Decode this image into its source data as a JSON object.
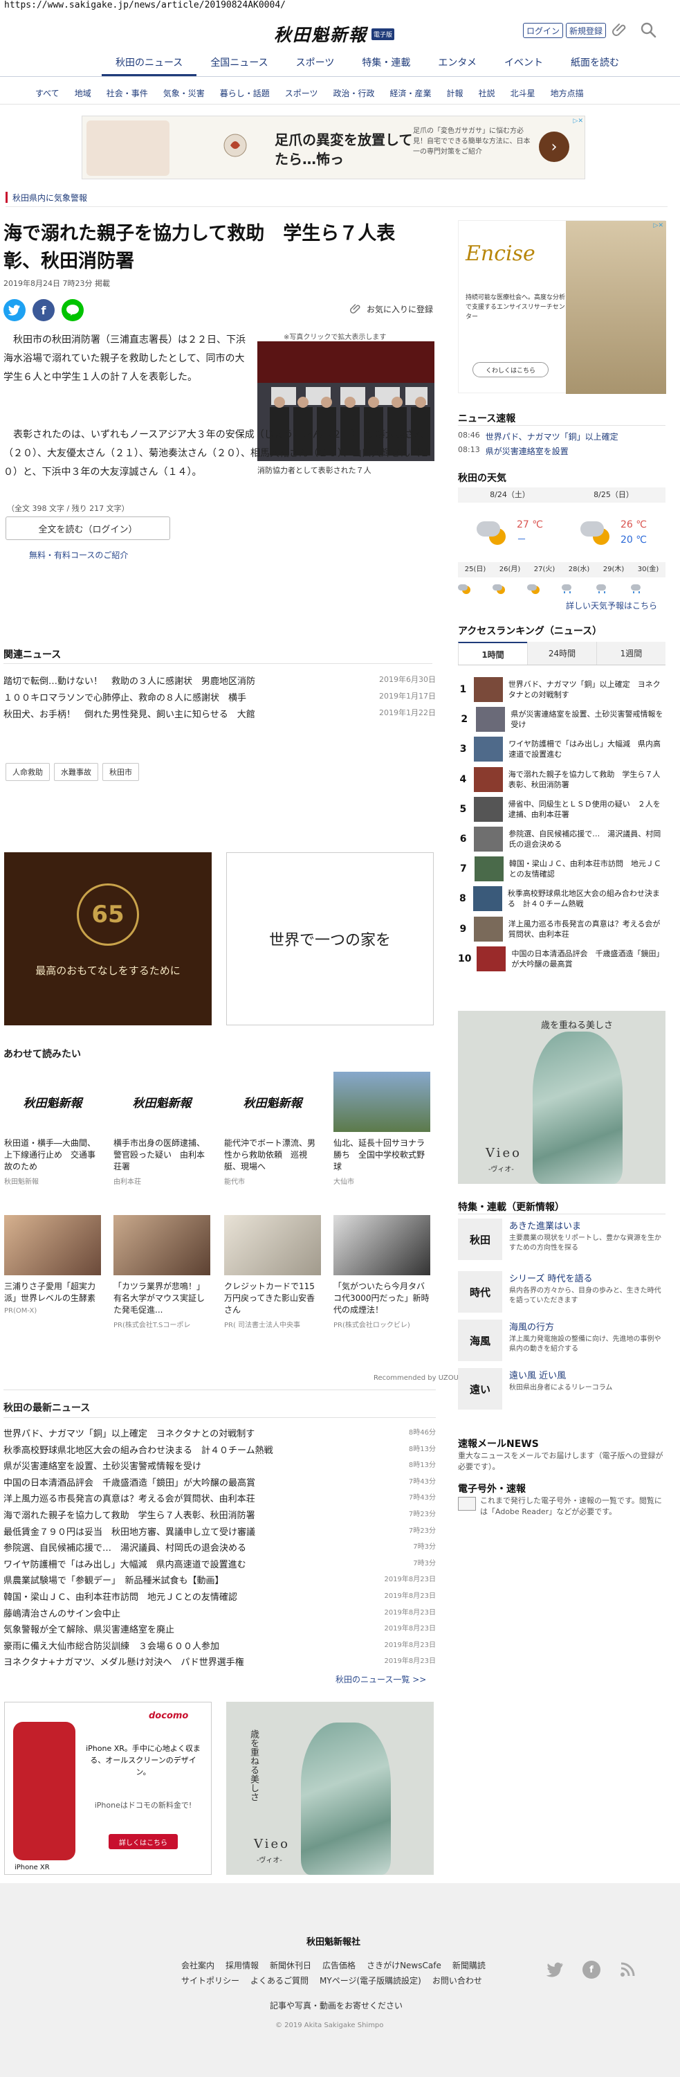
{
  "url": "https://www.sakigake.jp/news/article/20190824AK0004/",
  "header": {
    "logo_text": "秋田魁新報",
    "logo_badge": "電子版",
    "login": "ログイン",
    "register": "新規登録"
  },
  "main_nav": [
    "秋田のニュース",
    "全国ニュース",
    "スポーツ",
    "特集・連載",
    "エンタメ",
    "イベント",
    "紙面を読む"
  ],
  "sub_nav": [
    "すべて",
    "地域",
    "社会・事件",
    "気象・災害",
    "暮らし・話題",
    "スポーツ",
    "政治・行政",
    "経済・産業",
    "計報",
    "社説",
    "北斗星",
    "地方点描"
  ],
  "banner_ad": {
    "headline": "足爪の異変を放置してたら…怖っ",
    "subtext": "足爪の「変色ガサガサ」に悩む方必見！自宅でできる簡単な方法に、日本一の専門対策をご紹介",
    "ad_mark": "▷✕"
  },
  "alert": "秋田県内に気象警報",
  "article": {
    "title": "海で溺れた親子を協力して救助　学生ら７人表彰、秋田消防署",
    "date": "2019年8月24日 7時23分 掲載",
    "fav": "お気に入りに登録",
    "photo_hint": "※写真クリックで拡大表示します",
    "photo_caption": "消防協力者として表彰された７人",
    "para1": "秋田市の秋田消防署（三浦直志署長）は２２日、下浜海水浴場で溺れていた親子を救助したとして、同市の大学生６人と中学生１人の計７人を表彰した。",
    "para2": "表彰されたのは、いずれもノースアジア大３年の安保成（じょう）さん（２１）、伊藤大晟さん（２０）、大友優太さん（２１）、菊池奏汰さん（２０）、相馬大祐さん（２０）、山口大輝さん（２０）と、下浜中３年の大友淳誠さん（１４）。",
    "char_count": "（全文 398 文字 / 残り 217 文字）",
    "read_full": "全文を読む（ログイン）",
    "course_link": "無料・有料コースのご紹介"
  },
  "related": {
    "title": "関連ニュース",
    "items": [
      {
        "title": "踏切で転倒…動けない！　救助の３人に感謝状　男鹿地区消防",
        "date": "2019年6月30日"
      },
      {
        "title": "１００キロマラソンで心肺停止、救命の８人に感謝状　横手",
        "date": "2019年1月17日"
      },
      {
        "title": "秋田犬、お手柄！　倒れた男性発見、飼い主に知らせる　大館",
        "date": "2019年1月22日"
      }
    ],
    "tags": [
      "人命救助",
      "水難事故",
      "秋田市"
    ]
  },
  "ad_box1": {
    "emblem": "65",
    "copy": "最高のおもてなしをするために"
  },
  "ad_box2": {
    "copy": "世界で一つの家を"
  },
  "also_read": {
    "title": "あわせて読みたい",
    "cards": [
      {
        "title": "秋田道・横手―大曲間、上下線通行止め　交通事故のため",
        "source": "秋田魁新報",
        "logo": "秋田魁新報"
      },
      {
        "title": "横手市出身の医師逮捕、警官殴った疑い　由利本荘署",
        "source": "由利本荘",
        "logo": "秋田魁新報"
      },
      {
        "title": "能代沖でボート漂流、男性から救助依頼　巡視艇、現場へ",
        "source": "能代市",
        "logo": "秋田魁新報"
      },
      {
        "title": "仙北、延長十回サヨナラ勝ち　全国中学校軟式野球",
        "source": "大仙市",
        "logo": ""
      },
      {
        "title": "三浦りさ子愛用「超実力派」世界レベルの生酵素",
        "source": "PR(OM-X)",
        "logo": ""
      },
      {
        "title": "「カツラ業界が悲鳴！」有名大学がマウス実証した発毛促進...",
        "source": "PR(株式会社T.Sコーポレ",
        "logo": ""
      },
      {
        "title": "クレジットカードで115万円戻ってきた影山安香さん",
        "source": "PR( 司法書士法人中央事",
        "logo": ""
      },
      {
        "title": "「気がついたら今月タバコ代3000円だった」新時代の成煙法！",
        "source": "PR(株式会社ロックビレ)",
        "logo": ""
      }
    ],
    "recommended": "Recommended by UZOU"
  },
  "latest": {
    "title": "秋田の最新ニュース",
    "items": [
      {
        "title": "世界パド、ナガマツ「銅」以上確定　ヨネクタナとの対戦制す",
        "time": "8時46分"
      },
      {
        "title": "秋季高校野球県北地区大会の組み合わせ決まる　計４０チーム熱戦",
        "time": "8時13分"
      },
      {
        "title": "県が災害連絡室を設置、土砂災害警戒情報を受け",
        "time": "8時13分"
      },
      {
        "title": "中国の日本清酒品評会　千歳盛酒造「鏡田」が大吟醸の最高賞",
        "time": "7時43分"
      },
      {
        "title": "洋上風力巡る市長発言の真意は？考える会が質問状、由利本荘",
        "time": "7時43分"
      },
      {
        "title": "海で溺れた親子を協力して救助　学生ら７人表彰、秋田消防署",
        "time": "7時23分"
      },
      {
        "title": "最低賃金７９０円は妥当　秋田地方審、異議申し立て受け審議",
        "time": "7時23分"
      },
      {
        "title": "参院選、自民候補応援で…　湯沢議員、村岡氏の退会決める",
        "time": "7時3分"
      },
      {
        "title": "ワイヤ防護柵で「はみ出し」大幅減　県内高速道で設置進む",
        "time": "7時3分"
      },
      {
        "title": "県農業試験場で「参観デー」　新品種米試食も【動画】",
        "time": "2019年8月23日"
      },
      {
        "title": "韓国・梁山ＪＣ、由利本荘市訪問　地元ＪＣとの友情確認",
        "time": "2019年8月23日"
      },
      {
        "title": "藤嶋清治さんのサイン会中止",
        "time": "2019年8月23日"
      },
      {
        "title": "気象警報が全て解除、県災害連絡室を廃止",
        "time": "2019年8月23日"
      },
      {
        "title": "豪雨に備え大仙市総合防災訓練　３会場６００人参加",
        "time": "2019年8月23日"
      },
      {
        "title": "ヨネクタナ+ナガマツ、メダル懸け対決へ　パド世界選手権",
        "time": "2019年8月23日"
      }
    ],
    "more": "秋田のニュース一覧 >>"
  },
  "ad_iphone": {
    "docomo": "docomo",
    "copy1": "iPhone XR。手中に心地よく収まる、オールスクリーンのデザイン。",
    "copy2": "iPhoneはドコモの新料金で!",
    "btn": "詳しくはこちら",
    "brand": "iPhone XR"
  },
  "ad_dress": {
    "line1": "歳を重ねる美しさ",
    "brand": "Vieo",
    "sub": "-ヴィオ-"
  },
  "sidebar": {
    "ad1": {
      "brand": "Encise",
      "desc": "持続可能な医療社会へ。高度な分析で支援するエンサイスリサーチセンター",
      "btn": "くわしくはこちら"
    },
    "breaking_title": "ニュース速報",
    "breaking": [
      {
        "time": "08:46",
        "text": "世界パド、ナガマツ「銅」以上確定"
      },
      {
        "time": "08:13",
        "text": "県が災害連絡室を設置"
      }
    ],
    "weather": {
      "title": "秋田の天気",
      "days": [
        "8/24（土）",
        "8/25（日）"
      ],
      "today": {
        "hi": "27 ℃",
        "lo": "－"
      },
      "tomorrow": {
        "hi": "26 ℃",
        "lo": "20 ℃"
      },
      "week": [
        "25(日)",
        "26(月)",
        "27(火)",
        "28(水)",
        "29(木)",
        "30(金)"
      ],
      "link": "詳しい天気予報はこちら"
    },
    "ranking": {
      "title": "アクセスランキング（ニュース）",
      "tabs": [
        "1時間",
        "24時間",
        "1週間"
      ],
      "items": [
        {
          "n": "1",
          "text": "世界バド、ナガマツ「銅」以上確定　ヨネクタナとの対戦制す"
        },
        {
          "n": "2",
          "text": "県が災害連絡室を設置、土砂災害警戒情報を受け"
        },
        {
          "n": "3",
          "text": "ワイヤ防護柵で「はみ出し」大幅減　県内高速道で設置進む"
        },
        {
          "n": "4",
          "text": "海で溺れた親子を協力して救助　学生ら７人表彰、秋田消防署"
        },
        {
          "n": "5",
          "text": "帰省中、同級生とＬＳＤ使用の疑い　２人を逮捕、由利本荘署"
        },
        {
          "n": "6",
          "text": "参院選、自民候補応援で…　湯沢議員、村岡氏の退会決める"
        },
        {
          "n": "7",
          "text": "韓国・梁山ＪＣ、由利本荘市訪問　地元ＪＣとの友情確認"
        },
        {
          "n": "8",
          "text": "秋季高校野球県北地区大会の組み合わせ決まる　計４０チーム熱戦"
        },
        {
          "n": "9",
          "text": "洋上風力巡る市長発言の真意は？考える会が質問状、由利本荘"
        },
        {
          "n": "10",
          "text": "中国の日本清酒品評会　千歳盛酒造「鏡田」が大吟醸の最高賞"
        }
      ]
    },
    "features_title": "特集・連載（更新情報）",
    "features": [
      {
        "thumb": "秋田",
        "title": "あきた進業はいま",
        "desc": "主要農業の現状をリポートし、豊かな資源を生かすための方向性を探る"
      },
      {
        "thumb": "時代",
        "title": "シリーズ 時代を語る",
        "desc": "県内各界の方々から、目身の歩みと、生きた時代を語っていただきます"
      },
      {
        "thumb": "海風",
        "title": "海風の行方",
        "desc": "洋上風力発電施設の整備に向け、先進地の事例や県内の動きを紹介する"
      },
      {
        "thumb": "遠い",
        "title": "遠い風 近い風",
        "desc": "秋田県出身者によるリレーコラム"
      }
    ],
    "mail_title": "速報メールNEWS",
    "mail_desc": "重大なニュースをメールでお届けします（電子版への登録が必要です）。",
    "eshimen_title": "電子号外・速報",
    "eshimen_desc": "これまで発行した電子号外・速報の一覧です。閲覧には「Adobe Reader」などが必要です。"
  },
  "footer": {
    "company": "秋田魁新報社",
    "links1": [
      "会社案内",
      "採用情報",
      "新聞休刊日",
      "広告価格",
      "さきがけNewsCafe",
      "新聞購読"
    ],
    "links2": [
      "サイトポリシー",
      "よくあるご質問",
      "MYページ(電子版購読設定)",
      "お問い合わせ"
    ],
    "note": "記事や写真・動画をお寄せください",
    "copyright": "© 2019 Akita Sakigake Shimpo"
  }
}
